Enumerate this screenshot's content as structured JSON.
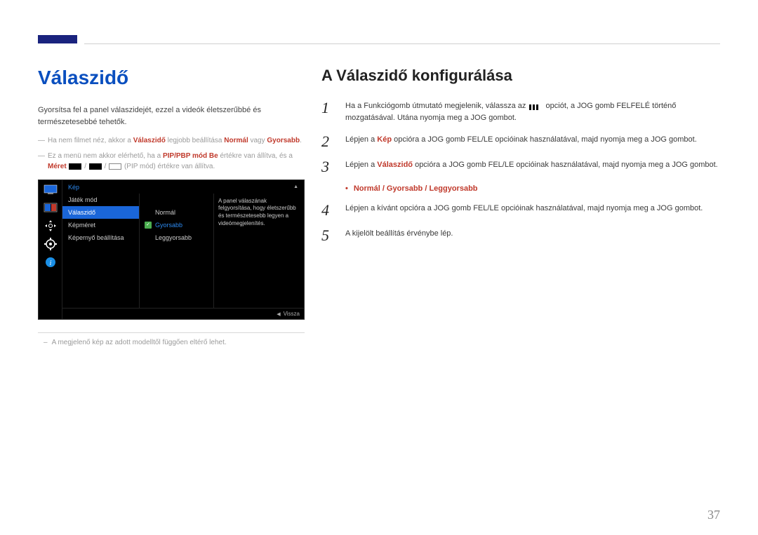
{
  "left": {
    "title": "Válaszidő",
    "intro": "Gyorsítsa fel a panel válaszidejét, ezzel a videók életszerűbbé és természetesebbé tehetők.",
    "note1_prefix": "Ha nem filmet néz, akkor a ",
    "note1_bold1": "Válaszidő",
    "note1_mid": " legjobb beállítása ",
    "note1_bold2": "Normál",
    "note1_mid2": " vagy ",
    "note1_bold3": "Gyorsabb",
    "note1_end": ".",
    "note2_prefix": "Ez a menü nem akkor elérhető, ha a ",
    "note2_bold1": "PIP/PBP mód Be",
    "note2_mid": " értékre van állítva, és a ",
    "note2_bold2": "Méret",
    "note2_end": " (PIP mód) értékre van állítva.",
    "post_note": "A megjelenő kép az adott modelltől függően eltérő lehet."
  },
  "osd": {
    "title": "Kép",
    "menu": {
      "item1": "Játék mód",
      "item2": "Válaszidő",
      "item3": "Képméret",
      "item4": "Képernyő beállítása"
    },
    "sub": {
      "opt1": "Normál",
      "opt2": "Gyorsabb",
      "opt3": "Leggyorsabb"
    },
    "desc": "A panel válaszának felgyorsítása, hogy életszerűbb és természetesebb legyen a videómegjelenítés.",
    "back": "Vissza"
  },
  "right": {
    "title": "A Válaszidő konfigurálása",
    "step1_a": "Ha a Funkciógomb útmutató megjelenik, válassza az ",
    "step1_b": " opciót, a JOG gomb FELFELÉ történő mozgatásával. Utána nyomja meg a JOG gombot.",
    "step2_a": "Lépjen a ",
    "step2_kep": "Kép",
    "step2_b": " opcióra a JOG gomb FEL/LE opcióinak használatával, majd nyomja meg a JOG gombot.",
    "step3_a": "Lépjen a ",
    "step3_val": "Válaszidő",
    "step3_b": " opcióra a JOG gomb FEL/LE opcióinak használatával, majd nyomja meg a JOG gombot.",
    "bullet": "Normál / Gyorsabb / Leggyorsabb",
    "step4": "Lépjen a kívánt opcióra a JOG gomb FEL/LE opcióinak használatával, majd nyomja meg a JOG gombot.",
    "step5": "A kijelölt beállítás érvénybe lép."
  },
  "page_number": "37"
}
